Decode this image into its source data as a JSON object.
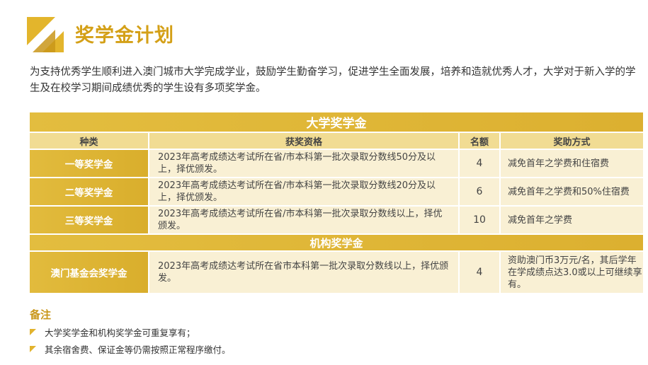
{
  "page": {
    "title": "奖学金计划",
    "intro": "为支持优秀学生顺利进入澳门城市大学完成学业，鼓励学生勤奋学习，促进学生全面发展，培养和造就优秀人才，大学对于新入学的学生及在校学习期间成绩优秀的学生设有多项奖学金。"
  },
  "colors": {
    "gold": "#d4a017",
    "gold_bar": "#e0b63a",
    "header_light": "#f1dc93",
    "row_bg": "#f9f0d4"
  },
  "icons": {
    "logo": "gold-triangle-logo",
    "bullet": "gold-triangle-bullet"
  },
  "table": {
    "section1": "大学奖学金",
    "headers": [
      "种类",
      "获奖资格",
      "名额",
      "奖助方式"
    ],
    "rows": [
      {
        "type": "一等奖学金",
        "requirement": "2023年高考成绩达考试所在省/市本科第一批次录取分数线50分及以上，择优颁发。",
        "count": "4",
        "reward": "减免首年之学费和住宿费"
      },
      {
        "type": "二等奖学金",
        "requirement": "2023年高考成绩达考试所在省/市本科第一批次录取分数线20分及以上，择优颁发。",
        "count": "6",
        "reward": "减免首年之学费和50%住宿费"
      },
      {
        "type": "三等奖学金",
        "requirement": "2023年高考成绩达考试所在省/市本科第一批次录取分数线以上，择优颁发。",
        "count": "10",
        "reward": "减免首年之学费"
      }
    ],
    "section2": "机构奖学金",
    "inst_row": {
      "type": "澳门基金会奖学金",
      "requirement": "2023年高考成绩达考试所在省市本科第一批次录取分数线以上，择优颁发。",
      "count": "4",
      "reward": "资助澳门币3万元/名，其后学年在学成绩点达3.0或以上可继续享有。"
    }
  },
  "notes": {
    "title": "备注",
    "items": [
      "大学奖学金和机构奖学金可重复享有；",
      "其余宿舍费、保证金等仍需按照正常程序缴付。"
    ]
  }
}
